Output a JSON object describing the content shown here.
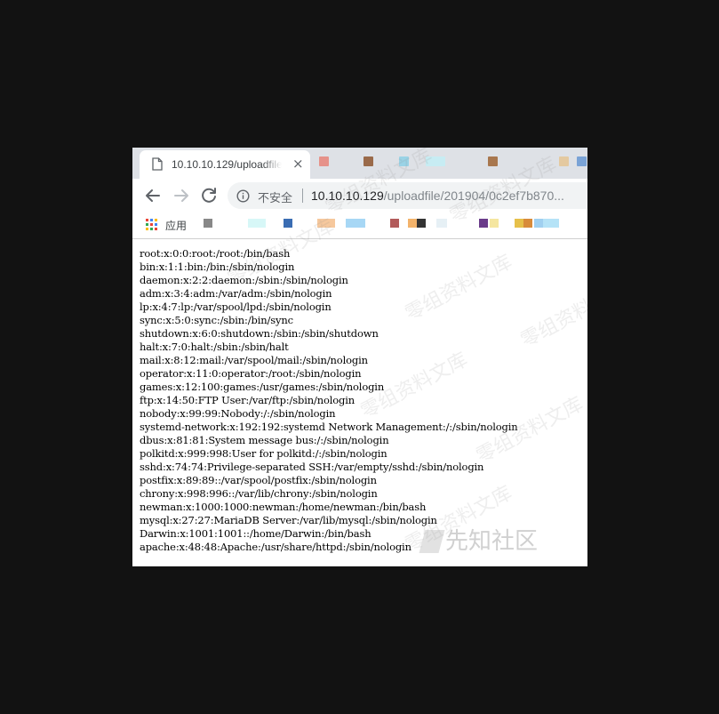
{
  "tab": {
    "title": "10.10.10.129/uploadfile",
    "close_glyph": "×"
  },
  "toolbar": {
    "security_text": "不安全",
    "url_host": "10.10.10.129",
    "url_path": "/uploadfile/201904/0c2ef7b870..."
  },
  "bookmarks": {
    "apps_label": "应用"
  },
  "icons": {
    "back": "arrow-left-icon",
    "forward": "arrow-right-icon",
    "reload": "reload-icon",
    "info": "info-icon",
    "document": "document-icon",
    "apps": "apps-grid-icon"
  },
  "colors": {
    "page_background": "#121212",
    "tabstrip": "#dee1e6",
    "omnibox": "#f1f3f4"
  },
  "passwd_lines": [
    "root:x:0:0:root:/root:/bin/bash",
    "bin:x:1:1:bin:/bin:/sbin/nologin",
    "daemon:x:2:2:daemon:/sbin:/sbin/nologin",
    "adm:x:3:4:adm:/var/adm:/sbin/nologin",
    "lp:x:4:7:lp:/var/spool/lpd:/sbin/nologin",
    "sync:x:5:0:sync:/sbin:/bin/sync",
    "shutdown:x:6:0:shutdown:/sbin:/sbin/shutdown",
    "halt:x:7:0:halt:/sbin:/sbin/halt",
    "mail:x:8:12:mail:/var/spool/mail:/sbin/nologin",
    "operator:x:11:0:operator:/root:/sbin/nologin",
    "games:x:12:100:games:/usr/games:/sbin/nologin",
    "ftp:x:14:50:FTP User:/var/ftp:/sbin/nologin",
    "nobody:x:99:99:Nobody:/:/sbin/nologin",
    "systemd-network:x:192:192:systemd Network Management:/:/sbin/nologin",
    "dbus:x:81:81:System message bus:/:/sbin/nologin",
    "polkitd:x:999:998:User for polkitd:/:/sbin/nologin",
    "sshd:x:74:74:Privilege-separated SSH:/var/empty/sshd:/sbin/nologin",
    "postfix:x:89:89::/var/spool/postfix:/sbin/nologin",
    "chrony:x:998:996::/var/lib/chrony:/sbin/nologin",
    "newman:x:1000:1000:newman:/home/newman:/bin/bash",
    "mysql:x:27:27:MariaDB Server:/var/lib/mysql:/sbin/nologin",
    "Darwin:x:1001:1001::/home/Darwin:/bin/bash",
    "apache:x:48:48:Apache:/usr/share/httpd:/sbin/nologin"
  ],
  "watermark_text": "零组资料文库",
  "logo_text": "先知社区"
}
